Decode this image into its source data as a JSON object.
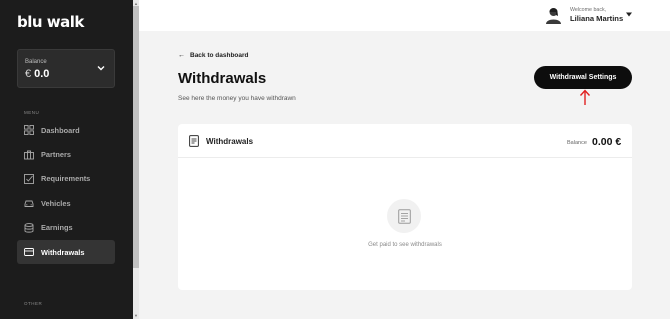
{
  "app": {
    "logo_text": "blu walk"
  },
  "sidebar": {
    "balance_label": "Balance",
    "balance_currency": "€",
    "balance_value": "0.0",
    "menu_label": "MENU",
    "other_label": "OTHER",
    "items": [
      {
        "label": "Dashboard",
        "icon": "grid-icon",
        "active": false
      },
      {
        "label": "Partners",
        "icon": "briefcase-icon",
        "active": false
      },
      {
        "label": "Requirements",
        "icon": "checkbox-icon",
        "active": false
      },
      {
        "label": "Vehicles",
        "icon": "car-icon",
        "active": false
      },
      {
        "label": "Earnings",
        "icon": "database-icon",
        "active": false
      },
      {
        "label": "Withdrawals",
        "icon": "credit-card-icon",
        "active": true
      }
    ]
  },
  "topbar": {
    "welcome": "Welcome back,",
    "user_name": "Liliana Martins"
  },
  "main": {
    "back_link": "Back to dashboard",
    "title": "Withdrawals",
    "subtitle": "See here the money you have withdrawn",
    "settings_button": "Withdrawal Settings",
    "card": {
      "title": "Withdrawals",
      "balance_label": "Balance",
      "balance_value": "0.00 €",
      "empty_text": "Get paid to see withdrawals"
    }
  },
  "colors": {
    "sidebar_bg": "#1c1c1c",
    "accent_dark": "#0d0d0d",
    "annotation_red": "#e02020"
  }
}
